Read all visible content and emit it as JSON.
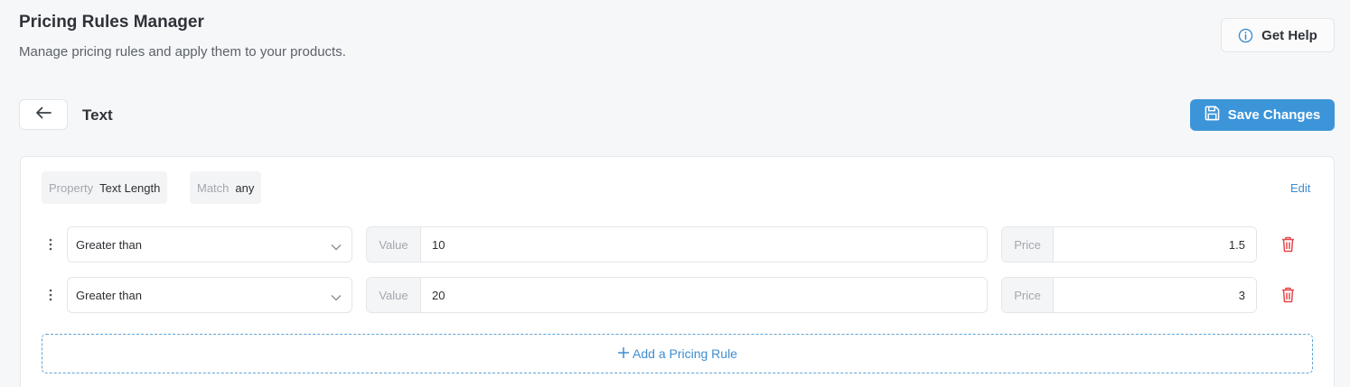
{
  "header": {
    "title": "Pricing Rules Manager",
    "subtitle": "Manage pricing rules and apply them to your products.",
    "help_label": "Get Help",
    "help_icon": "info-circle-icon"
  },
  "toolbar": {
    "back_icon": "arrow-left-icon",
    "rule_name": "Text",
    "save_label": "Save Changes",
    "save_icon": "floppy-disk-icon"
  },
  "colors": {
    "accent": "#3d95d9",
    "danger": "#e5484d",
    "background": "#f6f7f9"
  },
  "card": {
    "property_key": "Property",
    "property_value": "Text Length",
    "match_key": "Match",
    "match_value": "any",
    "edit_label": "Edit",
    "rules": [
      {
        "condition": "Greater than",
        "value_label": "Value",
        "value": "10",
        "price_label": "Price",
        "price": "1.5"
      },
      {
        "condition": "Greater than",
        "value_label": "Value",
        "value": "20",
        "price_label": "Price",
        "price": "3"
      }
    ],
    "add_rule_label": "Add a Pricing Rule"
  }
}
